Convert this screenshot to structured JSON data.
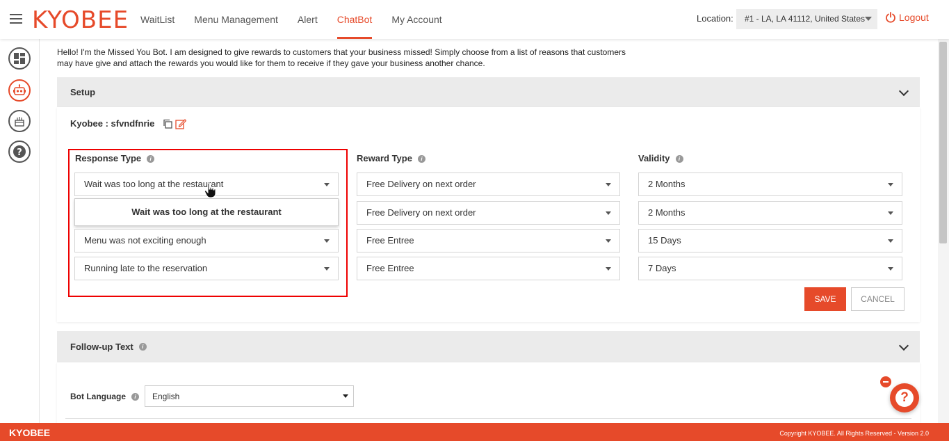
{
  "header": {
    "logo": "KYOBEE",
    "nav": [
      "WaitList",
      "Menu Management",
      "Alert",
      "ChatBot",
      "My Account"
    ],
    "active_nav": "ChatBot",
    "location_label": "Location:",
    "location_value": "#1 - LA, LA 41112, United States",
    "logout": "Logout"
  },
  "intro_text": "Hello! I'm the Missed You Bot. I am designed to give rewards to customers that your business missed! Simply choose from a list of reasons that customers may have give and attach the rewards you would like for them to receive if they gave your business another chance.",
  "setup": {
    "title": "Setup",
    "bot_name": "Kyobee : sfvndfnrie",
    "columns": {
      "response": "Response Type",
      "reward": "Reward Type",
      "validity": "Validity"
    },
    "rows": [
      {
        "response": "Wait was too long at the restaurant",
        "reward": "Free Delivery on next order",
        "validity": "2 Months"
      },
      {
        "response": "",
        "reward": "Free Delivery on next order",
        "validity": "2 Months"
      },
      {
        "response": "Menu was not exciting enough",
        "reward": "Free Entree",
        "validity": "15 Days"
      },
      {
        "response": "Running late to the reservation",
        "reward": "Free Entree",
        "validity": "7 Days"
      }
    ],
    "dropdown_option": "Wait was too long at the restaurant",
    "save": "SAVE",
    "cancel": "CANCEL"
  },
  "followup": {
    "title": "Follow-up Text",
    "bot_language_label": "Bot Language",
    "bot_language_value": "English"
  },
  "footer": {
    "brand": "KYOBEE",
    "copyright": "Copyright KYOBEE. All Rights Reserved - Version 2.0"
  },
  "colors": {
    "brand": "#e64a2a",
    "highlight": "#ee0000"
  },
  "icons": [
    "menu-icon",
    "dashboard-icon",
    "robot-icon",
    "cake-icon",
    "help-icon",
    "power-icon",
    "copy-icon",
    "edit-icon",
    "info-icon",
    "chevron-down-icon"
  ]
}
